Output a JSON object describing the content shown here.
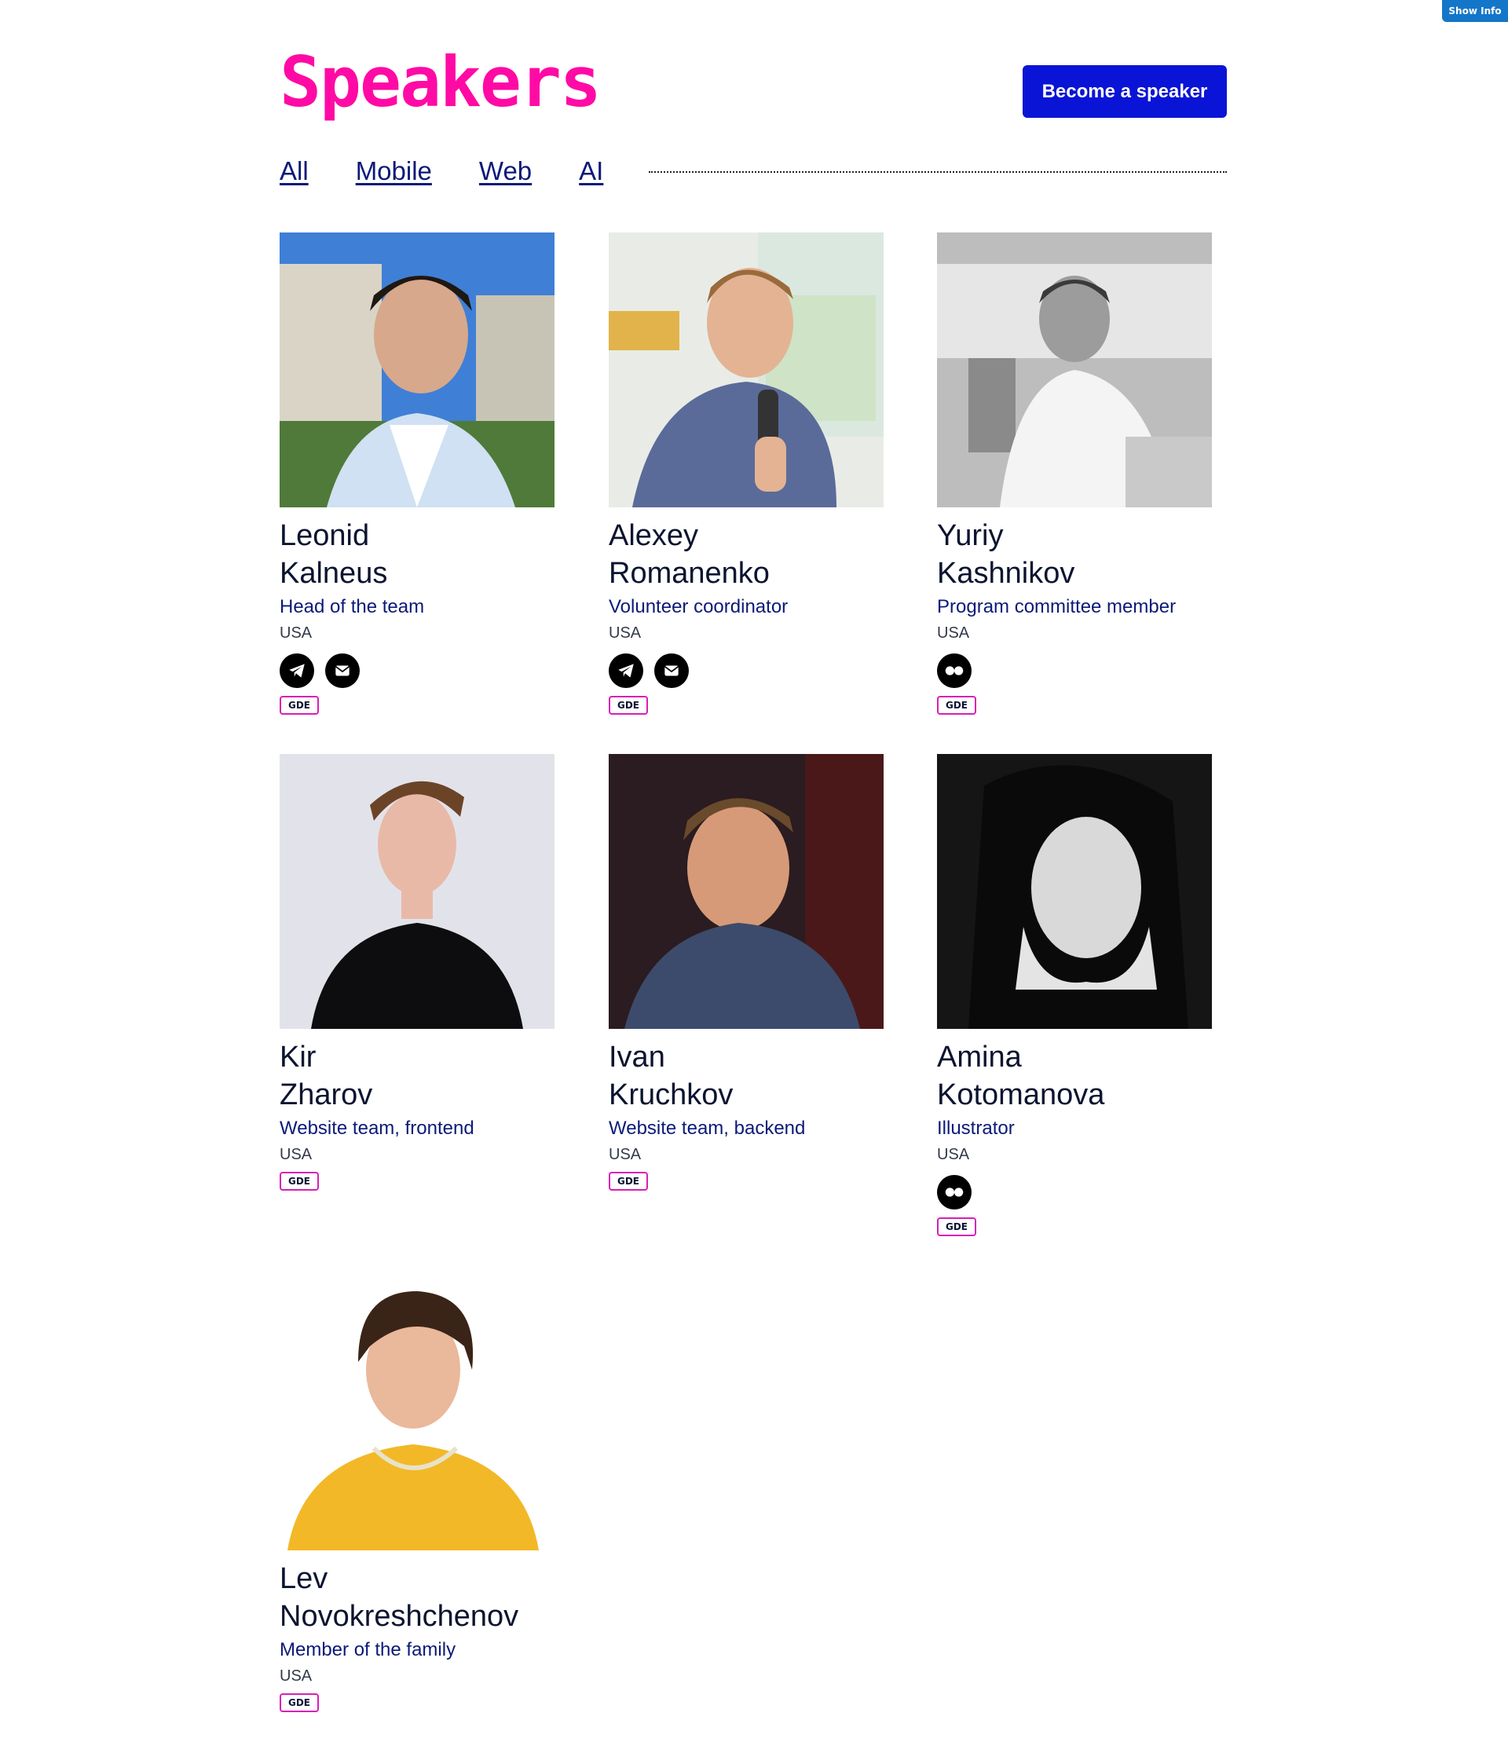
{
  "show_info_label": "Show Info",
  "page": {
    "title": "Speakers",
    "become_speaker_label": "Become a speaker"
  },
  "filters": [
    {
      "label": "All"
    },
    {
      "label": "Mobile"
    },
    {
      "label": "Web"
    },
    {
      "label": "AI"
    }
  ],
  "colors": {
    "title": "#ff0aa5",
    "button": "#0a14d6",
    "link": "#0b1a78",
    "badge_border": "#d81fb4"
  },
  "speakers": [
    {
      "first": "Leonid",
      "last": "Kalneus",
      "role": "Head of the team",
      "country": "USA",
      "socials": [
        "telegram-icon",
        "mail-icon"
      ],
      "badge": "GDE"
    },
    {
      "first": "Alexey",
      "last": "Romanenko",
      "role": "Volunteer coordinator",
      "country": "USA",
      "socials": [
        "telegram-icon",
        "mail-icon"
      ],
      "badge": "GDE"
    },
    {
      "first": "Yuriy",
      "last": "Kashnikov",
      "role": "Program committee member",
      "country": "USA",
      "socials": [
        "flickr-icon"
      ],
      "badge": "GDE"
    },
    {
      "first": "Kir",
      "last": "Zharov",
      "role": "Website team, frontend",
      "country": "USA",
      "socials": [],
      "badge": "GDE"
    },
    {
      "first": "Ivan",
      "last": "Kruchkov",
      "role": "Website team, backend",
      "country": "USA",
      "socials": [],
      "badge": "GDE"
    },
    {
      "first": "Amina",
      "last": "Kotomanova",
      "role": "Illustrator",
      "country": "USA",
      "socials": [
        "flickr-icon"
      ],
      "badge": "GDE"
    },
    {
      "first": "Lev",
      "last": "Novokreshchenov",
      "role": "Member of the family",
      "country": "USA",
      "socials": [],
      "badge": "GDE"
    }
  ]
}
